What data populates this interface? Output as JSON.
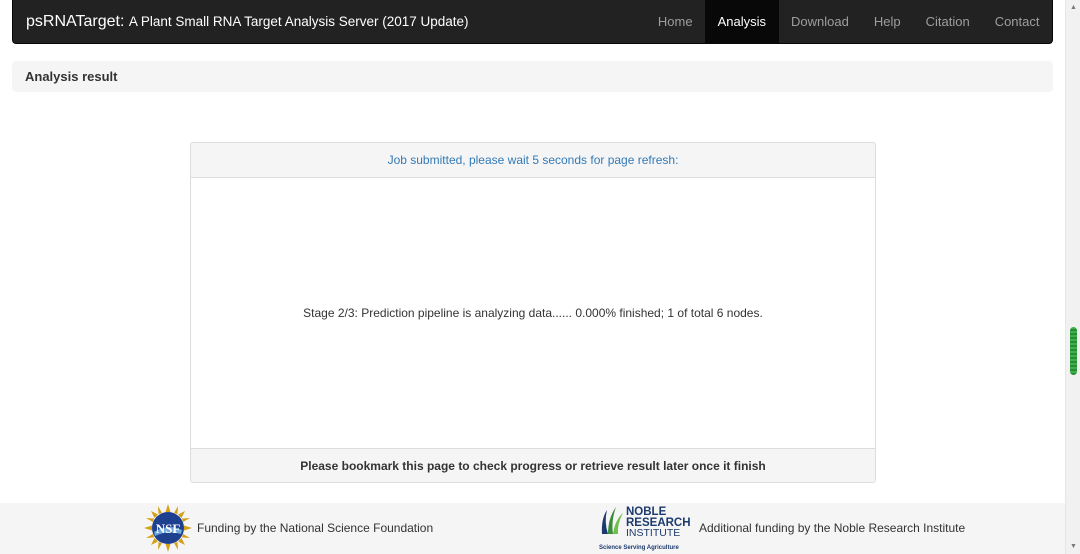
{
  "navbar": {
    "brand_name": "psRNATarget:",
    "brand_sub": "A Plant Small RNA Target Analysis Server (2017 Update)",
    "items": [
      {
        "label": "Home",
        "active": false
      },
      {
        "label": "Analysis",
        "active": true
      },
      {
        "label": "Download",
        "active": false
      },
      {
        "label": "Help",
        "active": false
      },
      {
        "label": "Citation",
        "active": false
      },
      {
        "label": "Contact",
        "active": false
      }
    ]
  },
  "result_header": "Analysis result",
  "panel": {
    "heading": "Job submitted, please wait 5 seconds for page refresh:",
    "status": "Stage 2/3: Prediction pipeline is analyzing data...... 0.000% finished; 1 of total 6 nodes.",
    "footer": "Please bookmark this page to check progress or retrieve result later once it finish"
  },
  "footer": {
    "nsf_logo_text": "NSF",
    "nsf_text": "Funding by the National Science Foundation",
    "noble_logo_line1": "NOBLE",
    "noble_logo_line2": "RESEARCH",
    "noble_logo_line3": "INSTITUTE",
    "noble_tagline": "Science Serving Agriculture",
    "noble_text": "Additional funding by the Noble Research Institute"
  },
  "colors": {
    "navbar_bg": "#222222",
    "nav_active_bg": "#080808",
    "link_blue": "#337ab7",
    "panel_bg": "#f5f5f5",
    "noble_navy": "#1c3a6e",
    "noble_green": "#3c8c3c",
    "scroll_thumb": "#3cb04a"
  },
  "icons": {
    "nsf": "nsf-logo",
    "noble": "noble-research-logo",
    "scroll_up": "chevron-up-icon",
    "scroll_down": "chevron-down-icon"
  }
}
